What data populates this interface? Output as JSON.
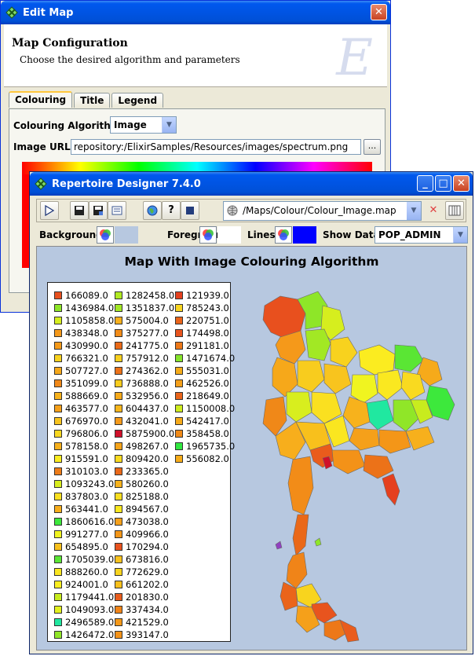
{
  "edit_map": {
    "title": "Edit Map",
    "header_title": "Map Configuration",
    "header_subtitle": "Choose the desired algorithm and parameters",
    "logo_letter": "E",
    "close_glyph": "✕",
    "tabs": [
      "Colouring",
      "Title",
      "Legend"
    ],
    "active_tab": "Colouring",
    "algorithm_label": "Colouring Algorithm:",
    "algorithm_value": "Image",
    "image_url_label": "Image URL:",
    "image_url_value": "repository:/ElixirSamples/Resources/images/spectrum.png",
    "browse_label": "..."
  },
  "designer": {
    "title": "Repertoire Designer 7.4.0",
    "buttons": {
      "minimize": "_",
      "maximize": "□",
      "close": "✕"
    },
    "toolbar": {
      "run_icon": "play-icon",
      "save_icon": "save-icon",
      "save_as_icon": "save-as-icon",
      "properties_icon": "properties-icon",
      "globe_icon": "globe-icon",
      "help_label": "?",
      "stop_icon": "square-icon",
      "path": "/Maps/Colour/Colour_Image.map",
      "delete_glyph": "✕",
      "columns_icon": "columns-icon"
    },
    "options": {
      "background_label": "Background:",
      "foreground_label": "Foreground:",
      "lines_label": "Lines:",
      "show_data_label": "Show Data:",
      "show_data_value": "POP_ADMIN",
      "background_color": "#b7c8e0",
      "foreground_color": "#ffffff",
      "lines_color": "#0000ff"
    },
    "map_title": "Map With Image Colouring Algorithm"
  },
  "legend": {
    "columns": [
      [
        {
          "v": "166089.0",
          "c": "#e8501e"
        },
        {
          "v": "1436984.0",
          "c": "#8ee628"
        },
        {
          "v": "1105858.0",
          "c": "#d6ee1e"
        },
        {
          "v": "438348.0",
          "c": "#f5991a"
        },
        {
          "v": "430990.0",
          "c": "#f59a1a"
        },
        {
          "v": "766321.0",
          "c": "#f8d21e"
        },
        {
          "v": "507727.0",
          "c": "#f6a81a"
        },
        {
          "v": "351099.0",
          "c": "#f08818"
        },
        {
          "v": "588669.0",
          "c": "#f7b21c"
        },
        {
          "v": "463577.0",
          "c": "#f5a01a"
        },
        {
          "v": "676970.0",
          "c": "#f8c41e"
        },
        {
          "v": "796806.0",
          "c": "#f9d820"
        },
        {
          "v": "578158.0",
          "c": "#f7b01c"
        },
        {
          "v": "915591.0",
          "c": "#fbec20"
        },
        {
          "v": "310103.0",
          "c": "#ee7c18"
        },
        {
          "v": "1093243.0",
          "c": "#d8ee1e"
        },
        {
          "v": "837803.0",
          "c": "#fae020"
        },
        {
          "v": "563441.0",
          "c": "#f7ae1c"
        },
        {
          "v": "1860616.0",
          "c": "#3de83c"
        },
        {
          "v": "991277.0",
          "c": "#f0f420"
        },
        {
          "v": "654895.0",
          "c": "#f8c01c"
        },
        {
          "v": "1705039.0",
          "c": "#5ae634"
        },
        {
          "v": "888260.0",
          "c": "#fae620"
        },
        {
          "v": "924001.0",
          "c": "#fbee20"
        },
        {
          "v": "1179441.0",
          "c": "#c8ec1e"
        },
        {
          "v": "1049093.0",
          "c": "#e2f01e"
        },
        {
          "v": "2496589.0",
          "c": "#20e8a0"
        },
        {
          "v": "1426472.0",
          "c": "#90e628"
        }
      ],
      [
        {
          "v": "1282458.0",
          "c": "#b0ea22"
        },
        {
          "v": "1351837.0",
          "c": "#a2e824"
        },
        {
          "v": "575004.0",
          "c": "#f7b01c"
        },
        {
          "v": "375277.0",
          "c": "#f28c18"
        },
        {
          "v": "241775.0",
          "c": "#ea6a18"
        },
        {
          "v": "757912.0",
          "c": "#f8d01e"
        },
        {
          "v": "274362.0",
          "c": "#ec7218"
        },
        {
          "v": "736888.0",
          "c": "#f8cc1e"
        },
        {
          "v": "532956.0",
          "c": "#f6aa1a"
        },
        {
          "v": "604437.0",
          "c": "#f7b61c"
        },
        {
          "v": "432041.0",
          "c": "#f59a1a"
        },
        {
          "v": "5875900.0",
          "c": "#d0102a"
        },
        {
          "v": "498267.0",
          "c": "#f6a41a"
        },
        {
          "v": "809420.0",
          "c": "#f9da20"
        },
        {
          "v": "233365.0",
          "c": "#ea6818"
        },
        {
          "v": "580260.0",
          "c": "#f7b21c"
        },
        {
          "v": "825188.0",
          "c": "#f9de20"
        },
        {
          "v": "894567.0",
          "c": "#fae820"
        },
        {
          "v": "473038.0",
          "c": "#f5a01a"
        },
        {
          "v": "409966.0",
          "c": "#f49618"
        },
        {
          "v": "170294.0",
          "c": "#e8521e"
        },
        {
          "v": "673816.0",
          "c": "#f8c21e"
        },
        {
          "v": "772629.0",
          "c": "#f8d41e"
        },
        {
          "v": "661202.0",
          "c": "#f8c01c"
        },
        {
          "v": "201830.0",
          "c": "#e95c1c"
        },
        {
          "v": "337434.0",
          "c": "#f08418"
        },
        {
          "v": "421529.0",
          "c": "#f49818"
        },
        {
          "v": "393147.0",
          "c": "#f39218"
        }
      ],
      [
        {
          "v": "121939.0",
          "c": "#e5401e"
        },
        {
          "v": "785243.0",
          "c": "#f9d620"
        },
        {
          "v": "220751.0",
          "c": "#ea641a"
        },
        {
          "v": "174498.0",
          "c": "#e8541e"
        },
        {
          "v": "291181.0",
          "c": "#ed7818"
        },
        {
          "v": "1471674.0",
          "c": "#86e42a"
        },
        {
          "v": "555031.0",
          "c": "#f6ac1a"
        },
        {
          "v": "462526.0",
          "c": "#f5a01a"
        },
        {
          "v": "218649.0",
          "c": "#ea641a"
        },
        {
          "v": "1150008.0",
          "c": "#ceec1e"
        },
        {
          "v": "542417.0",
          "c": "#f6aa1a"
        },
        {
          "v": "358458.0",
          "c": "#f08a18"
        },
        {
          "v": "1965735.0",
          "c": "#30e840"
        },
        {
          "v": "556082.0",
          "c": "#f6ac1a"
        }
      ]
    ]
  }
}
